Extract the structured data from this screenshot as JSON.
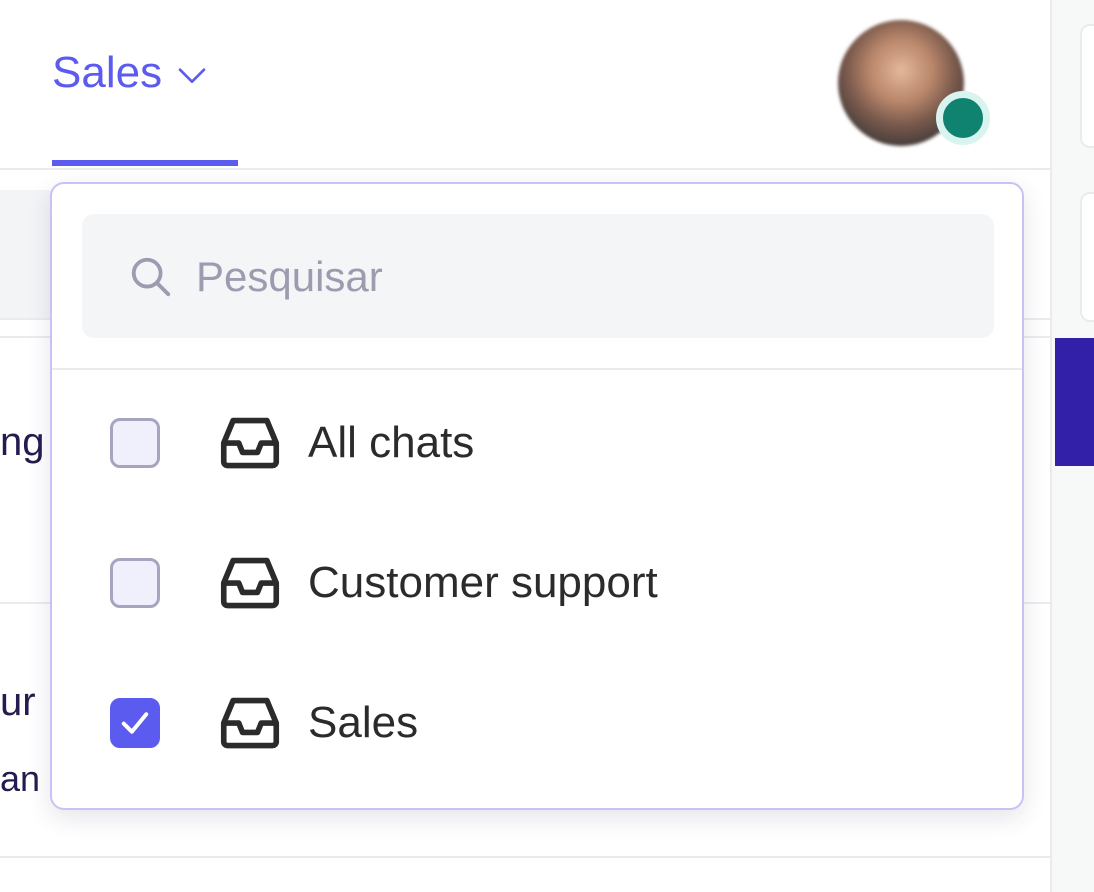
{
  "header": {
    "team_tab": {
      "label": "Sales",
      "icon": "chevron-down-icon"
    },
    "avatar": {
      "status": "online",
      "status_color": "#0f8270"
    }
  },
  "background_list": {
    "row1_text": "ng",
    "row2_text": "ur",
    "row2_sub": "an"
  },
  "dropdown": {
    "search": {
      "placeholder": "Pesquisar",
      "value": "",
      "icon": "search-icon"
    },
    "options": [
      {
        "label": "All chats",
        "checked": false,
        "icon": "inbox-icon"
      },
      {
        "label": "Customer support",
        "checked": false,
        "icon": "inbox-icon"
      },
      {
        "label": "Sales",
        "checked": true,
        "icon": "inbox-icon"
      }
    ]
  },
  "colors": {
    "accent": "#5b5bf0",
    "dark_band": "#3320a8",
    "border": "#c7c4f5",
    "text": "#2b2b2b",
    "placeholder": "#9c9cb0"
  }
}
